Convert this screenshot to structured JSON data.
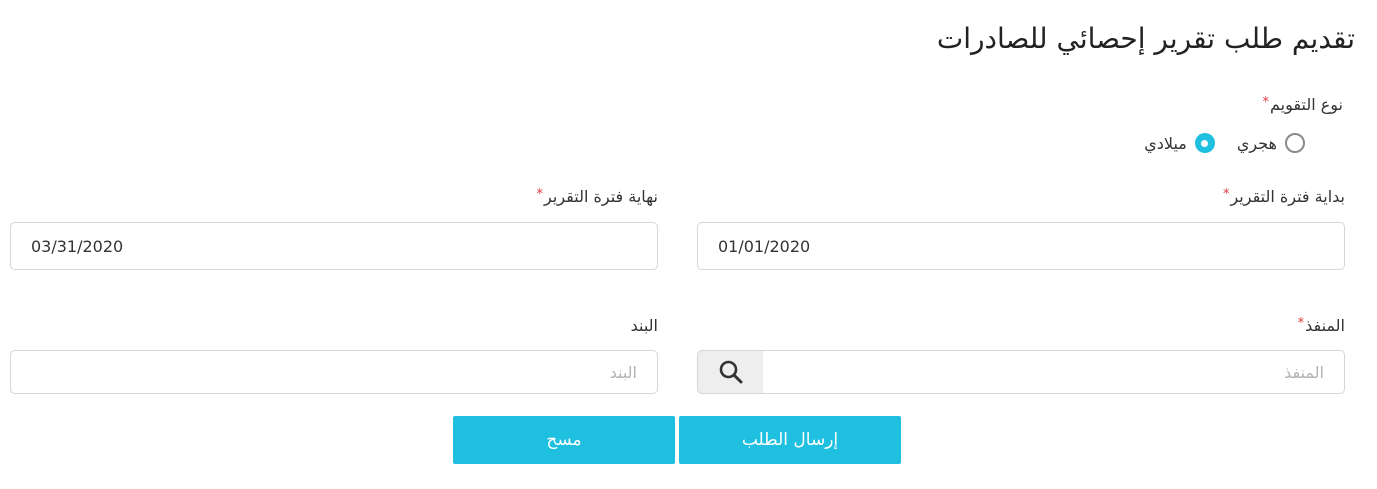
{
  "page": {
    "title": "تقديم طلب تقرير إحصائي للصادرات"
  },
  "calendar_type": {
    "label": "نوع التقويم",
    "required_mark": "*",
    "options": [
      {
        "label": "هجري",
        "selected": false
      },
      {
        "label": "ميلادي",
        "selected": true
      }
    ]
  },
  "period_start": {
    "label": "بداية فترة التقرير",
    "required_mark": "*",
    "value": "01/01/2020"
  },
  "period_end": {
    "label": "نهاية فترة التقرير",
    "required_mark": "*",
    "value": "03/31/2020"
  },
  "port": {
    "label": "المنفذ",
    "required_mark": "*",
    "placeholder": "المنفذ",
    "search_icon": "search-icon"
  },
  "item": {
    "label": "البند",
    "placeholder": "البند"
  },
  "actions": {
    "submit_label": "إرسال الطلب",
    "clear_label": "مسح"
  },
  "colors": {
    "accent": "#1ebfdf",
    "required": "#e0383e",
    "border": "#d6d6d6"
  }
}
